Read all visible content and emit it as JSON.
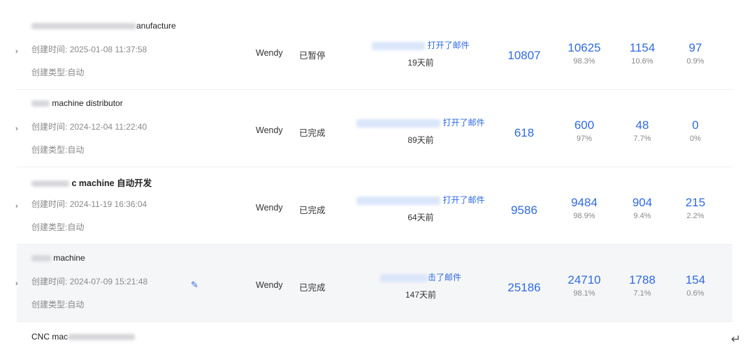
{
  "rows": [
    {
      "title_visible": "anufacture",
      "created_label": "创建时间:",
      "created_value": "2025-01-08 11:37:58",
      "type_label": "创建类型:",
      "type_value": "自动",
      "owner": "Wendy",
      "status": "已暂停",
      "email_action": "打开了邮件",
      "email_ago": "19天前",
      "sent": "10807",
      "delivered": "10625",
      "delivered_pct": "98.3%",
      "opened": "1154",
      "opened_pct": "10.6%",
      "clicked": "97",
      "clicked_pct": "0.9%"
    },
    {
      "title_visible": "machine distributor",
      "created_label": "创建时间:",
      "created_value": "2024-12-04 11:22:40",
      "type_label": "创建类型:",
      "type_value": "自动",
      "owner": "Wendy",
      "status": "已完成",
      "email_action": "打开了邮件",
      "email_ago": "89天前",
      "sent": "618",
      "delivered": "600",
      "delivered_pct": "97%",
      "opened": "48",
      "opened_pct": "7.7%",
      "clicked": "0",
      "clicked_pct": "0%"
    },
    {
      "title_visible": "c machine 自动开发",
      "created_label": "创建时间:",
      "created_value": "2024-11-19 16:36:04",
      "type_label": "创建类型:",
      "type_value": "自动",
      "owner": "Wendy",
      "status": "已完成",
      "email_action": "打开了邮件",
      "email_ago": "64天前",
      "sent": "9586",
      "delivered": "9484",
      "delivered_pct": "98.9%",
      "opened": "904",
      "opened_pct": "9.4%",
      "clicked": "215",
      "clicked_pct": "2.2%"
    },
    {
      "title_visible": "machine",
      "created_label": "创建时间:",
      "created_value": "2024-07-09 15:21:48",
      "type_label": "创建类型:",
      "type_value": "自动",
      "owner": "Wendy",
      "status": "已完成",
      "email_action": "击了邮件",
      "email_ago": "147天前",
      "sent": "25186",
      "delivered": "24710",
      "delivered_pct": "98.1%",
      "opened": "1788",
      "opened_pct": "7.1%",
      "clicked": "154",
      "clicked_pct": "0.6%"
    }
  ],
  "partial_row_title": "CNC mac",
  "icons": {
    "expand": "chevron-right-icon",
    "edit": "pencil-icon",
    "enter": "enter-return-icon"
  },
  "colors": {
    "accent": "#2e6be6",
    "hover_row": "#f5f6f7",
    "muted_text": "#8a8a8a"
  }
}
